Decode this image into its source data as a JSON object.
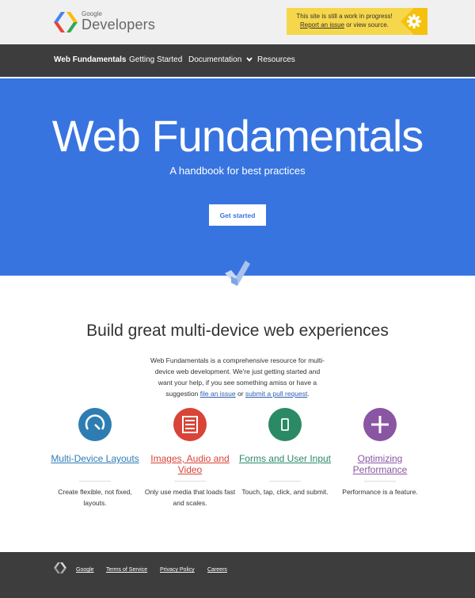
{
  "header": {
    "logo_google": "Google",
    "logo_developers": "Developers",
    "notice": {
      "line1": "This site is still a work in progress!",
      "link": "Report an issue",
      "line2_rest": " or view source."
    }
  },
  "nav": {
    "items": [
      {
        "label": "Web Fundamentals"
      },
      {
        "label": "Getting Started"
      },
      {
        "label": "Documentation"
      },
      {
        "label": "Resources"
      }
    ]
  },
  "hero": {
    "title": "Web Fundamentals",
    "subtitle": "A handbook for best practices",
    "button": "Get started",
    "bg_color": "#3874e0"
  },
  "main": {
    "title": "Build great multi-device web experiences",
    "intro_text": "Web Fundamentals is a comprehensive resource for multi-device web development. We're just getting started and want your help, if you see something amiss or have a suggestion ",
    "intro_link1": "file an issue",
    "intro_or": " or ",
    "intro_link2": "submit a pull request",
    "intro_end": ".",
    "features": [
      {
        "title": "Multi-Device Layouts",
        "desc": "Create flexible, not fixed, layouts.",
        "color": "#2d7db3",
        "icon": "gauge-icon"
      },
      {
        "title": "Images, Audio and Video",
        "desc": "Only use media that loads fast and scales.",
        "color": "#d94338",
        "icon": "document-icon"
      },
      {
        "title": "Forms and User Input",
        "desc": "Touch, tap, click, and submit.",
        "color": "#2a8a66",
        "icon": "phone-icon"
      },
      {
        "title": "Optimizing Performance",
        "desc": "Performance is a feature.",
        "color": "#8a55a3",
        "icon": "plus-icon"
      }
    ]
  },
  "footer": {
    "links": [
      {
        "label": "Google"
      },
      {
        "label": "Terms of Service"
      },
      {
        "label": "Privacy Policy"
      },
      {
        "label": "Careers"
      }
    ]
  }
}
